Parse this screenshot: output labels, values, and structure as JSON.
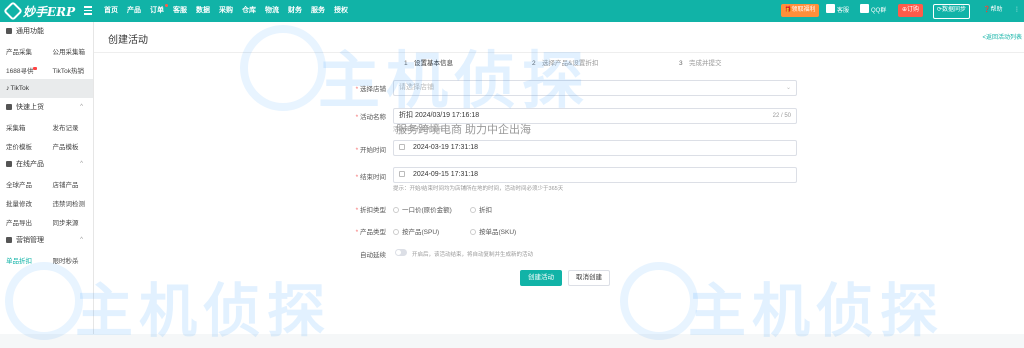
{
  "topbar": {
    "logo": "妙手ERP",
    "nav": [
      "首页",
      "产品",
      "订单",
      "客服",
      "数据",
      "采购",
      "仓库",
      "物流",
      "财务",
      "服务",
      "授权"
    ],
    "right": {
      "badge": "领取福利",
      "service": "客服",
      "qq": "QQ群",
      "order": "订购",
      "sync": "数据同步",
      "help": "帮助"
    }
  },
  "sidebar": {
    "sec1": "通用功能",
    "r1": [
      "产品采集",
      "公用采集箱"
    ],
    "r2": [
      "1688寻供",
      "TikTok热销"
    ],
    "active": "TikTok",
    "sec2": "快速上货",
    "r3": [
      "采集箱",
      "发布记录"
    ],
    "r4": [
      "定价模板",
      "产品模板"
    ],
    "sec3": "在线产品",
    "r5": [
      "全球产品",
      "店铺产品"
    ],
    "r6": [
      "批量修改",
      "违禁词检测"
    ],
    "r7": [
      "产品导出",
      "同步来源"
    ],
    "sec4": "营销管理",
    "r8": [
      "单品折扣",
      "限时秒杀"
    ]
  },
  "page": {
    "title": "创建活动",
    "back": "<返回活动列表",
    "steps": [
      {
        "n": "1",
        "label": "设置基本信息"
      },
      {
        "n": "2",
        "label": "选择产品&设置折扣"
      },
      {
        "n": "3",
        "label": "完成并提交"
      }
    ]
  },
  "form": {
    "shop_label": "选择店铺",
    "shop_placeholder": "请选择店铺",
    "name_label": "活动名称",
    "name_value": "折扣 2024/03/19 17:16:18",
    "name_count": "22 / 50",
    "name_hint": "活动名称不对外显示",
    "start_label": "开始时间",
    "start_value": "2024-03-19 17:31:18",
    "end_label": "结束时间",
    "end_value": "2024-09-15 17:31:18",
    "time_hint": "提示：开始/结束时间均为店铺所在地的时间，活动时间必须少于365天",
    "discount_label": "折扣类型",
    "discount_opts": [
      "一口价(原价金额)",
      "折扣"
    ],
    "range_label": "产品类型",
    "range_opts": [
      "按产品(SPU)",
      "按单品(SKU)"
    ],
    "renew_label": "自动延续",
    "renew_hint": "开启后，该活动结束，将自动复制并生成新的活动",
    "create_btn": "创建活动",
    "cancel_btn": "取消创建"
  },
  "watermark": {
    "text": "主机侦探",
    "slogan": "服务跨境电商  助力中企出海"
  },
  "colors": {
    "accent": "#11b3a7",
    "required": "#f56c6c",
    "orange": "#ff8f3a",
    "red": "#ff5b4a"
  }
}
